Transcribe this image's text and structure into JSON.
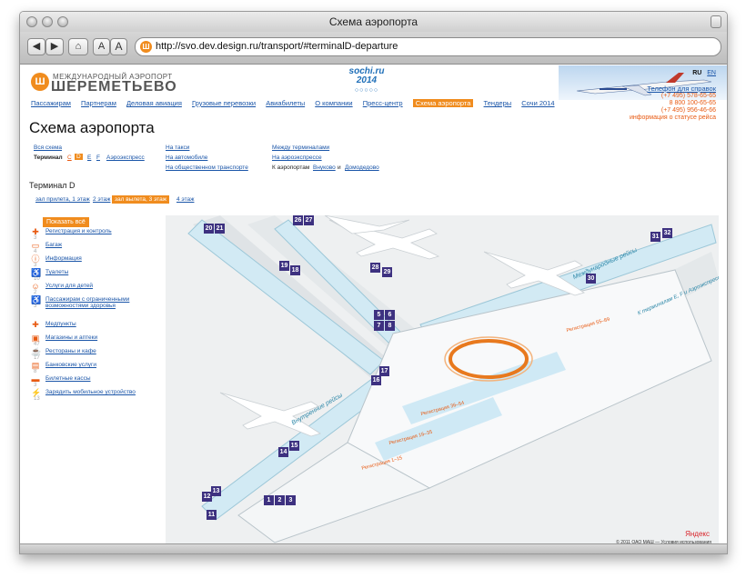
{
  "browser": {
    "title": "Схема аэропорта",
    "url": "http://svo.dev.design.ru/transport/#terminalD-departure",
    "home_icon": "home-icon",
    "text_smaller": "A",
    "text_larger": "A"
  },
  "header": {
    "logo_top": "МЕЖДУНАРОДНЫЙ АЭРОПОРТ",
    "logo_main": "ШЕРЕМЕТЬЕВО",
    "sochi_text": "sochi.ru 2014",
    "lang": [
      "RU",
      "EN"
    ],
    "phone_title": "Телефон для справок",
    "phones": [
      "(+7 495) 578-65-65",
      "8 800 100-65-65",
      "(+7 495) 956-46-66"
    ],
    "phone_note": "информация о статусе рейса"
  },
  "nav": [
    {
      "label": "Пассажирам",
      "active": false
    },
    {
      "label": "Партнерам",
      "active": false
    },
    {
      "label": "Деловая авиация",
      "active": false
    },
    {
      "label": "Грузовые перевозки",
      "active": false
    },
    {
      "label": "Авиабилеты",
      "active": false
    },
    {
      "label": "О компании",
      "active": false
    },
    {
      "label": "Пресс-центр",
      "active": false
    },
    {
      "label": "Схема аэропорта",
      "active": true
    },
    {
      "label": "Тендеры",
      "active": false
    },
    {
      "label": "Сочи 2014",
      "active": false
    }
  ],
  "page": {
    "title": "Схема аэропорта",
    "all_scheme": "Вся схема",
    "terminal_label": "Терминал",
    "terminals": [
      "C",
      "D",
      "E",
      "F"
    ],
    "aeroexpress": "Аэроэкспресс",
    "by_taxi": "На такси",
    "by_car": "На автомобиле",
    "by_public": "На общественном транспорте",
    "between_terminals": "Между терминалами",
    "to_aeroexpress": "На аэроэкспрессе",
    "to_airports": "К аэропортам",
    "vnukovo": "Внуково",
    "and": "и",
    "domodedovo": "Домодедово",
    "terminal_title": "Терминал D",
    "floors": [
      "зал прилета, 1 этаж",
      "2 этаж",
      "зал вылета, 3 этаж",
      "4 этаж"
    ]
  },
  "legend": {
    "show_all": "Показать всё",
    "items": [
      {
        "label": "Регистрация и контроль",
        "count": "3",
        "icon": "checkin-icon",
        "glyph": "✚"
      },
      {
        "label": "Багаж",
        "count": "4",
        "icon": "baggage-icon",
        "glyph": "▭"
      },
      {
        "label": "Информация",
        "count": "3",
        "icon": "info-icon",
        "glyph": "ⓘ"
      },
      {
        "label": "Туалеты",
        "count": "10",
        "icon": "toilet-icon",
        "glyph": "♿"
      },
      {
        "label": "Услуги для детей",
        "count": "2",
        "icon": "children-icon",
        "glyph": "☺"
      },
      {
        "label": "Пассажирам с ограниченными возможностями здоровья",
        "count": "3",
        "icon": "accessibility-icon",
        "glyph": "♿"
      },
      {
        "label": "Медпункты",
        "count": "",
        "icon": "medical-icon",
        "glyph": "✚"
      },
      {
        "label": "Магазины и аптеки",
        "count": "47",
        "icon": "shop-icon",
        "glyph": "▣"
      },
      {
        "label": "Рестораны и кафе",
        "count": "17",
        "icon": "restaurant-icon",
        "glyph": "☕"
      },
      {
        "label": "Банковские услуги",
        "count": "8",
        "icon": "bank-icon",
        "glyph": "▤"
      },
      {
        "label": "Билетные кассы",
        "count": "3",
        "icon": "tickets-icon",
        "glyph": "▬"
      },
      {
        "label": "Зарядить мобильное устройство",
        "count": "13",
        "icon": "charging-icon",
        "glyph": "⚡"
      }
    ]
  },
  "map": {
    "international_flights": "Международные рейсы",
    "domestic_flights": "Внутренние рейсы",
    "to_terminals": "К терминалам E, F и Аэроэкспрессу",
    "registration_labels": [
      "Регистрация 55–89",
      "Регистрация 36–54",
      "Регистрация 16–35",
      "Регистрация 1–15"
    ],
    "gates": [
      "1",
      "2",
      "3",
      "5",
      "6",
      "7",
      "8",
      "11",
      "12",
      "13",
      "14",
      "15",
      "16",
      "17",
      "18",
      "19",
      "20",
      "21",
      "26",
      "27",
      "28",
      "29",
      "30",
      "31",
      "32"
    ],
    "copyright": "© 2011 ОАО МАШ — Условия использования",
    "yandex": "Яндекс"
  }
}
